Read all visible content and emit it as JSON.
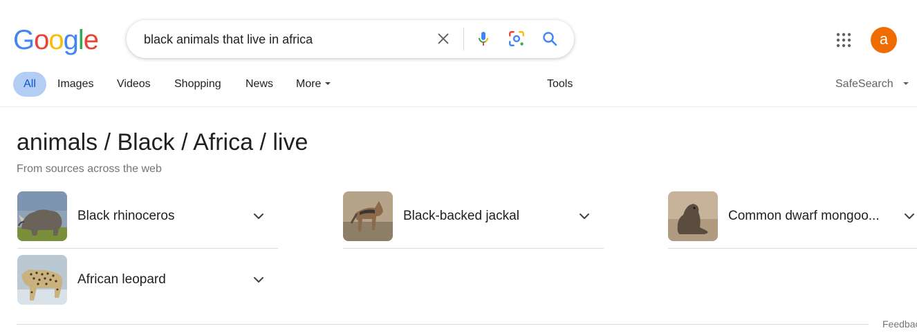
{
  "logo": {
    "letters": [
      "G",
      "o",
      "o",
      "g",
      "l",
      "e"
    ],
    "colors": [
      "#4285f4",
      "#ea4335",
      "#fbbc05",
      "#4285f4",
      "#34a853",
      "#ea4335"
    ]
  },
  "search": {
    "query": "black animals that live in africa"
  },
  "icons": {
    "clear": "close-icon",
    "voice": "microphone-icon",
    "lens": "camera-lens-icon",
    "search": "search-icon",
    "apps": "apps-grid-icon"
  },
  "account": {
    "avatar_letter": "a",
    "avatar_color": "#ef6c00"
  },
  "tabs": [
    {
      "label": "All",
      "active": true
    },
    {
      "label": "Images"
    },
    {
      "label": "Videos"
    },
    {
      "label": "Shopping"
    },
    {
      "label": "News"
    },
    {
      "label": "More"
    }
  ],
  "tools_label": "Tools",
  "safesearch_label": "SafeSearch",
  "results": {
    "heading": "animals / Black / Africa / live",
    "subheading": "From sources across the web",
    "entities": [
      {
        "label": "Black rhinoceros",
        "thumb": "rhinoceros-photo"
      },
      {
        "label": "Black-backed jackal",
        "thumb": "jackal-photo"
      },
      {
        "label": "Common dwarf mongoo...",
        "thumb": "mongoose-photo"
      },
      {
        "label": "African leopard",
        "thumb": "leopard-photo"
      }
    ]
  },
  "feedback_label": "Feedback"
}
